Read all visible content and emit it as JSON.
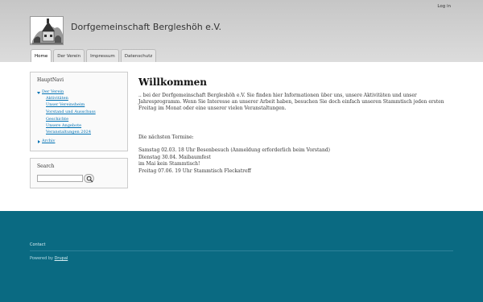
{
  "header": {
    "login_label": "Log in",
    "site_name": "Dorfgemeinschaft Bergleshöh e.V.",
    "logo_icon": "village-logo-icon"
  },
  "tabs": [
    {
      "label": "Home",
      "active": true
    },
    {
      "label": "Der Verein",
      "active": false
    },
    {
      "label": "Impressum",
      "active": false
    },
    {
      "label": "Datenschutz",
      "active": false
    }
  ],
  "sidebar": {
    "nav_title": "HauptNavi",
    "nav_items": [
      {
        "label": "Der Verein"
      },
      {
        "label": "Aktivitäten"
      },
      {
        "label": "Unser Vereinsheim"
      },
      {
        "label": "Vorstand und Ausschuss"
      },
      {
        "label": "Geschichte"
      },
      {
        "label": "Unsere Angebote"
      },
      {
        "label": "Veranstaltungen 2024"
      },
      {
        "label": "Archiv"
      }
    ],
    "search_title": "Search",
    "search_placeholder": ""
  },
  "main": {
    "title": "Willkommen",
    "intro": ".. bei der Dorfgemeinschaft Bergleshöh e.V. Sie finden hier Informationen über uns, unsere Aktivitäten und unser Jahresprogramm. Wenn Sie Interesse an unserer Arbeit haben, besuchen Sie doch einfach unseren Stammtisch jeden ersten Freitag im Monat oder eine unserer vielen Veranstaltungen.",
    "termine_heading": "Die nächsten Termine:",
    "events": [
      "Samstag 02.03. 18 Uhr Besenbesuch (Anmeldung erforderlich beim Vorstand)",
      "Dienstag 30.04. Maibaumfest",
      "im Mai kein Stammtisch!",
      "Freitag 07.06. 19 Uhr Stammtisch Fleckatreff"
    ]
  },
  "footer": {
    "contact": "Contact",
    "powered_prefix": "Powered by",
    "powered_link": "Drupal"
  },
  "colors": {
    "link": "#0071b3",
    "footer_bg": "#0a6a82",
    "header_bg": "#c6c6c6"
  }
}
